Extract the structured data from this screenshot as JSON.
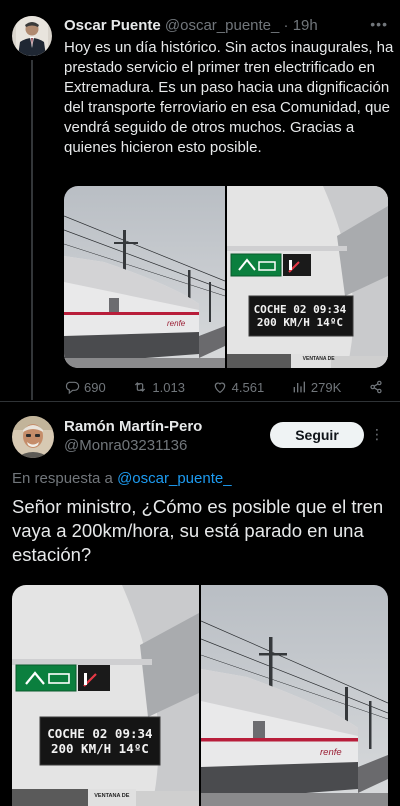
{
  "tweet": {
    "author_name": "Oscar Puente",
    "author_handle": "@oscar_puente_",
    "time": "· 19h",
    "text": "Hoy es un día histórico. Sin actos inaugurales, ha prestado servicio el primer tren electrificado en Extremadura. Es un paso hacia una dignificación del transporte ferroviario en esa Comunidad, que vendrá seguido de otros muchos. Gracias a quienes hicieron esto posible.",
    "display_line1": "COCHE 02 09:34",
    "display_line2": "200 KM/H  14ºC",
    "plate_label": "VENTANA DE",
    "metrics": {
      "replies": "690",
      "retweets": "1.013",
      "likes": "4.561",
      "views": "279K"
    }
  },
  "reply": {
    "author_name": "Ramón Martín-Pero",
    "author_handle": "@Monra03231136",
    "follow_label": "Seguir",
    "in_reply_prefix": "En respuesta a ",
    "in_reply_handle": "@oscar_puente_",
    "text": "Señor ministro, ¿Cómo es posible que el tren vaya a 200km/hora, su está parado en una estación?",
    "display_line1": "COCHE 02 09:34",
    "display_line2": "200 KM/H  14ºC",
    "plate_label": "VENTANA DE"
  },
  "colors": {
    "background": "#000000",
    "text": "#e7e9ea",
    "muted": "#71767b",
    "link": "#1d9bf0"
  },
  "icons": [
    "reply-icon",
    "retweet-icon",
    "like-icon",
    "views-icon",
    "share-icon",
    "more-icon"
  ]
}
